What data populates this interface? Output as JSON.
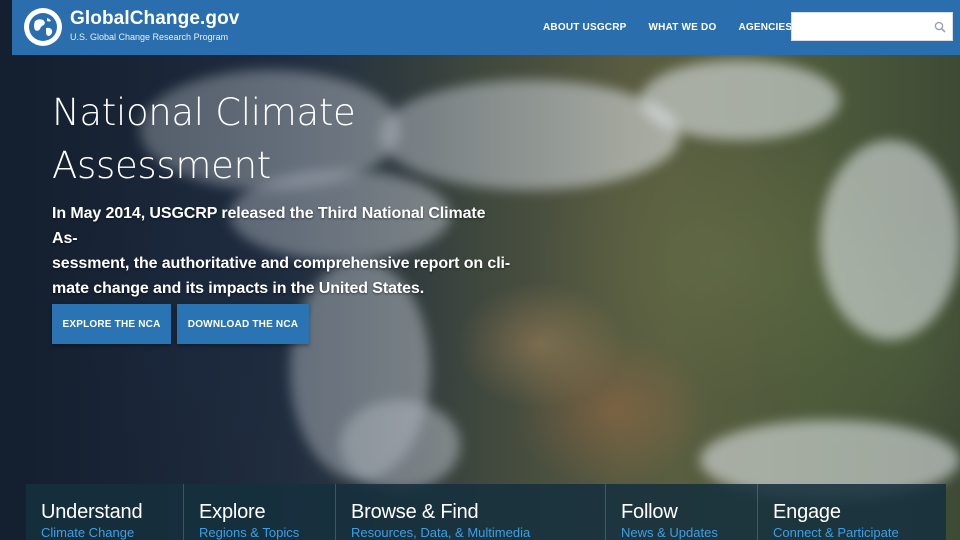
{
  "site": {
    "title": "GlobalChange.gov",
    "subtitle": "U.S. Global Change Research Program"
  },
  "nav": {
    "items": [
      {
        "label": "ABOUT USGCRP"
      },
      {
        "label": "WHAT WE DO"
      },
      {
        "label": "AGENCIES"
      }
    ]
  },
  "search": {
    "value": "",
    "placeholder": ""
  },
  "hero": {
    "title_line1": "National Climate",
    "title_line2": "Assessment",
    "text_line1": "In May 2014, USGCRP released the Third National Climate As-",
    "text_line2": "sessment, the authoritative and comprehensive report on cli-",
    "text_line3": "mate change and its impacts in the United States.",
    "buttons": {
      "explore": "EXPLORE THE NCA",
      "download": "DOWNLOAD THE NCA"
    }
  },
  "tiles": [
    {
      "heading": "Understand",
      "sub": "Climate Change"
    },
    {
      "heading": "Explore",
      "sub": "Regions & Topics"
    },
    {
      "heading": "Browse & Find",
      "sub": "Resources, Data, & Multimedia"
    },
    {
      "heading": "Follow",
      "sub": "News & Updates"
    },
    {
      "heading": "Engage",
      "sub": "Connect & Participate"
    }
  ],
  "colors": {
    "header": "#2b6eae",
    "button": "#2a74b4",
    "tile_link": "#3aa0e6",
    "tile_bar": "#16303e"
  },
  "icons": [
    "globe-logo-icon",
    "search-icon"
  ]
}
